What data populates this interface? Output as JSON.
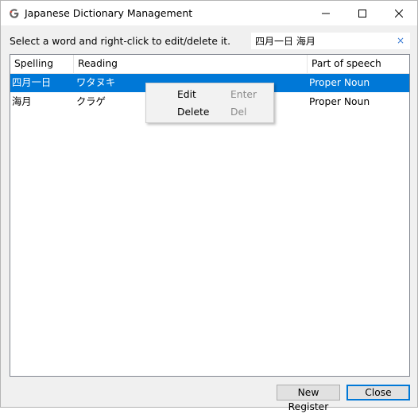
{
  "window": {
    "title": "Japanese Dictionary Management",
    "icon": "google-g-icon",
    "controls": [
      "minimize-icon",
      "maximize-icon",
      "close-icon"
    ]
  },
  "instruction": "Select a word and right-click to edit/delete it.",
  "search": {
    "value": "四月一日 海月",
    "clear_icon": "×"
  },
  "list": {
    "columns": [
      "Spelling",
      "Reading",
      "Part of speech"
    ],
    "rows": [
      {
        "spelling": "四月一日",
        "reading": "ワタヌキ",
        "pos": "Proper Noun",
        "selected": true
      },
      {
        "spelling": "海月",
        "reading": "クラゲ",
        "pos": "Proper Noun",
        "selected": false
      }
    ]
  },
  "context_menu": {
    "items": [
      {
        "label": "Edit",
        "shortcut": "Enter"
      },
      {
        "label": "Delete",
        "shortcut": "Del"
      }
    ]
  },
  "buttons": {
    "new_register": "New Register",
    "close": "Close"
  },
  "colors": {
    "selection": "#0078d7",
    "window_bg": "#f0f0f0",
    "accent": "#0078d7"
  }
}
